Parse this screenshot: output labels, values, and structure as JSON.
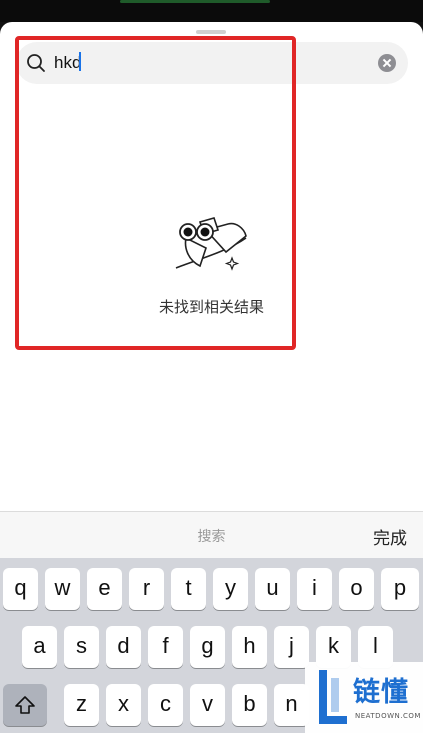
{
  "search": {
    "query": "hkd"
  },
  "empty_state": {
    "message": "未找到相关结果",
    "illustration": "binoculars-illustration"
  },
  "keyboard_toolbar": {
    "hint": "搜索",
    "done_label": "完成"
  },
  "keyboard": {
    "row1": [
      "q",
      "w",
      "e",
      "r",
      "t",
      "y",
      "u",
      "i",
      "o",
      "p"
    ],
    "row2": [
      "a",
      "s",
      "d",
      "f",
      "g",
      "h",
      "j",
      "k",
      "l"
    ],
    "row3": [
      "z",
      "x",
      "c",
      "v",
      "b",
      "n"
    ]
  },
  "watermark": {
    "title": "链懂",
    "subtitle": "NEATDOWN.COM"
  },
  "colors": {
    "highlight": "#e02626",
    "sheet_bg": "#ffffff",
    "keyboard_bg": "#d3d5db",
    "watermark_blue": "#1e6fd0"
  }
}
